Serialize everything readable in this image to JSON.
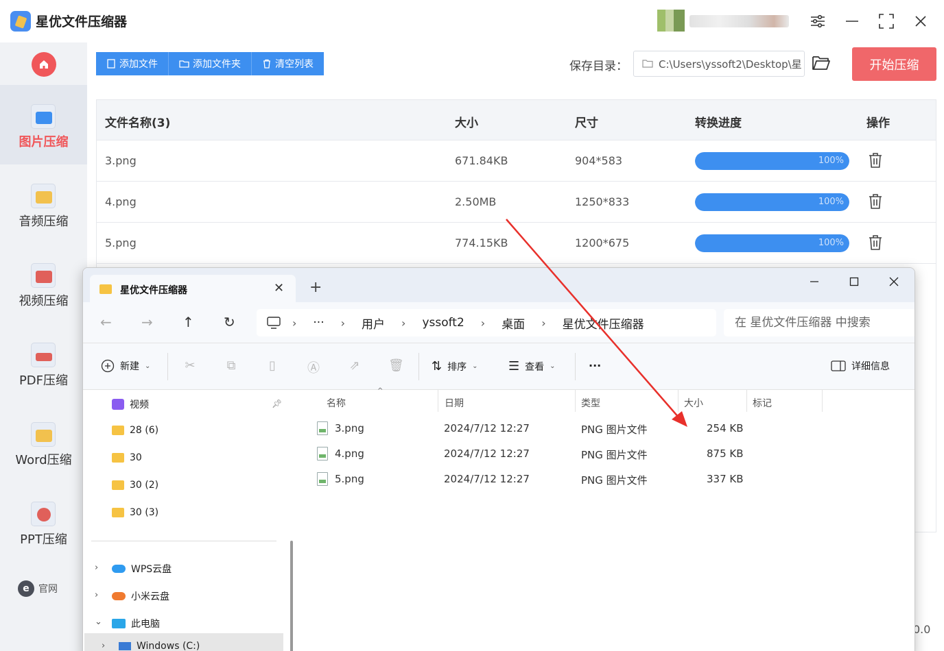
{
  "app": {
    "title": "星优文件压缩器",
    "save_label": "保存目录：",
    "save_path": "C:\\Users\\yssoft2\\Desktop\\星",
    "start_button": "开始压缩",
    "website_label": "官网",
    "version_partial": "0.0",
    "toolbar": {
      "add_file": "添加文件",
      "add_folder": "添加文件夹",
      "clear_list": "清空列表"
    },
    "sidebar": [
      {
        "label": "图片压缩",
        "icon": "image-icon",
        "active": true,
        "color": "#3d8ff0"
      },
      {
        "label": "音频压缩",
        "icon": "audio-icon",
        "active": false,
        "color": "#f2c14e"
      },
      {
        "label": "视频压缩",
        "icon": "video-icon",
        "active": false,
        "color": "#e0605a"
      },
      {
        "label": "PDF压缩",
        "icon": "pdf-icon",
        "active": false,
        "color": "#e0605a"
      },
      {
        "label": "Word压缩",
        "icon": "word-icon",
        "active": false,
        "color": "#f2c14e"
      },
      {
        "label": "PPT压缩",
        "icon": "ppt-icon",
        "active": false,
        "color": "#e0605a"
      }
    ],
    "table": {
      "headers": [
        "文件名称(3)",
        "大小",
        "尺寸",
        "转换进度",
        "操作"
      ],
      "rows": [
        {
          "name": "3.png",
          "size": "671.84KB",
          "dims": "904*583",
          "progress": 100,
          "progress_text": "100%"
        },
        {
          "name": "4.png",
          "size": "2.50MB",
          "dims": "1250*833",
          "progress": 100,
          "progress_text": "100%"
        },
        {
          "name": "5.png",
          "size": "774.15KB",
          "dims": "1200*675",
          "progress": 100,
          "progress_text": "100%"
        }
      ]
    }
  },
  "explorer": {
    "tab_title": "星优文件压缩器",
    "breadcrumb": [
      "用户",
      "yssoft2",
      "桌面",
      "星优文件压缩器"
    ],
    "search_placeholder": "在 星优文件压缩器 中搜索",
    "commands": {
      "new": "新建",
      "sort": "排序",
      "view": "查看",
      "more": "···",
      "details": "详细信息"
    },
    "nav_tree": [
      {
        "label": "视频",
        "kind": "video"
      },
      {
        "label": "28 (6)",
        "kind": "folder"
      },
      {
        "label": "30",
        "kind": "folder"
      },
      {
        "label": "30 (2)",
        "kind": "folder"
      },
      {
        "label": "30 (3)",
        "kind": "folder"
      }
    ],
    "nav_places": [
      {
        "label": "WPS云盘",
        "chevron": "›"
      },
      {
        "label": "小米云盘",
        "chevron": "›"
      },
      {
        "label": "此电脑",
        "chevron": "⌄"
      },
      {
        "label": "Windows (C:)",
        "chevron": "›"
      }
    ],
    "columns": [
      "名称",
      "日期",
      "类型",
      "大小",
      "标记"
    ],
    "files": [
      {
        "name": "3.png",
        "date": "2024/7/12 12:27",
        "type": "PNG 图片文件",
        "size": "254 KB"
      },
      {
        "name": "4.png",
        "date": "2024/7/12 12:27",
        "type": "PNG 图片文件",
        "size": "875 KB"
      },
      {
        "name": "5.png",
        "date": "2024/7/12 12:27",
        "type": "PNG 图片文件",
        "size": "337 KB"
      }
    ]
  },
  "colors": {
    "accent_blue": "#3d8ff0",
    "accent_red": "#f0676a",
    "arrow_red": "#e8302b"
  }
}
